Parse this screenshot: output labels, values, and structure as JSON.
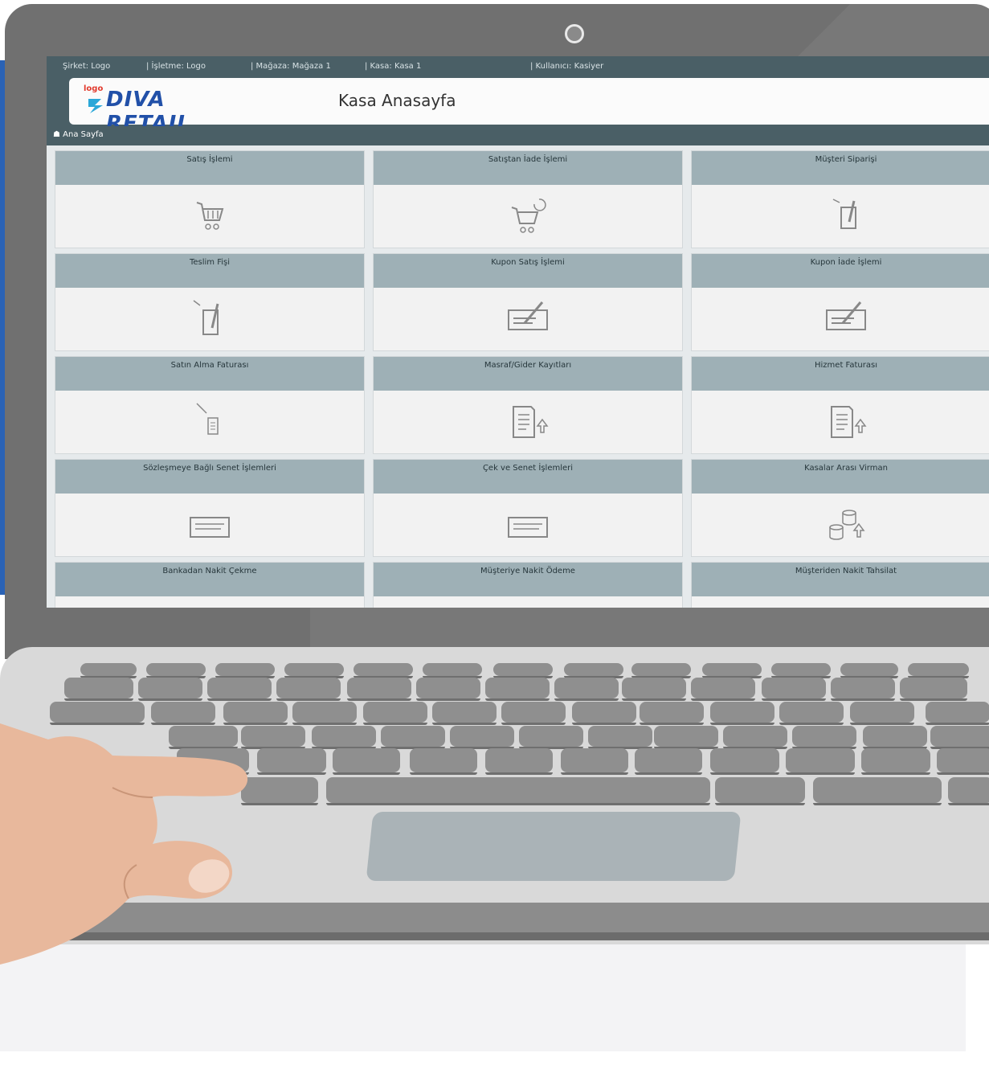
{
  "status_bar": {
    "company": "Şirket: Logo",
    "business": "| İşletme: Logo",
    "store": "| Mağaza: Mağaza 1",
    "register": "| Kasa: Kasa 1",
    "user": "| Kullanıcı: Kasiyer"
  },
  "header": {
    "logo_small": "logo",
    "logo_text": "DIVA RETAIL",
    "page_title": "Kasa Anasayfa"
  },
  "breadcrumb": {
    "home_icon": "home-icon",
    "label": "Ana Sayfa"
  },
  "tiles": [
    {
      "label": "Satış İşlemi",
      "icon": "cart-icon"
    },
    {
      "label": "Satıştan İade İşlemi",
      "icon": "cart-return-icon"
    },
    {
      "label": "Müşteri Siparişi",
      "icon": "order-icon"
    },
    {
      "label": "Teslim Fişi",
      "icon": "delivery-slip-icon"
    },
    {
      "label": "Kupon Satış İşlemi",
      "icon": "coupon-icon"
    },
    {
      "label": "Kupon İade İşlemi",
      "icon": "coupon-icon"
    },
    {
      "label": "Satın Alma Faturası",
      "icon": "purchase-invoice-icon"
    },
    {
      "label": "Masraf/Gider Kayıtları",
      "icon": "expense-icon"
    },
    {
      "label": "Hizmet Faturası",
      "icon": "service-invoice-icon"
    },
    {
      "label": "Sözleşmeye Bağlı Senet İşlemleri",
      "icon": "note-icon"
    },
    {
      "label": "Çek ve Senet İşlemleri",
      "icon": "note-icon"
    },
    {
      "label": "Kasalar Arası Virman",
      "icon": "transfer-icon"
    },
    {
      "label": "Bankadan Nakit Çekme",
      "icon": "bank-icon"
    },
    {
      "label": "Müşteriye Nakit Ödeme",
      "icon": "payment-icon"
    },
    {
      "label": "Müşteriden Nakit Tahsilat",
      "icon": "collection-icon"
    }
  ],
  "colors": {
    "accent_blue": "#2a62b5",
    "header_dark": "#4a5f66",
    "tile_head": "#9eb0b6"
  }
}
